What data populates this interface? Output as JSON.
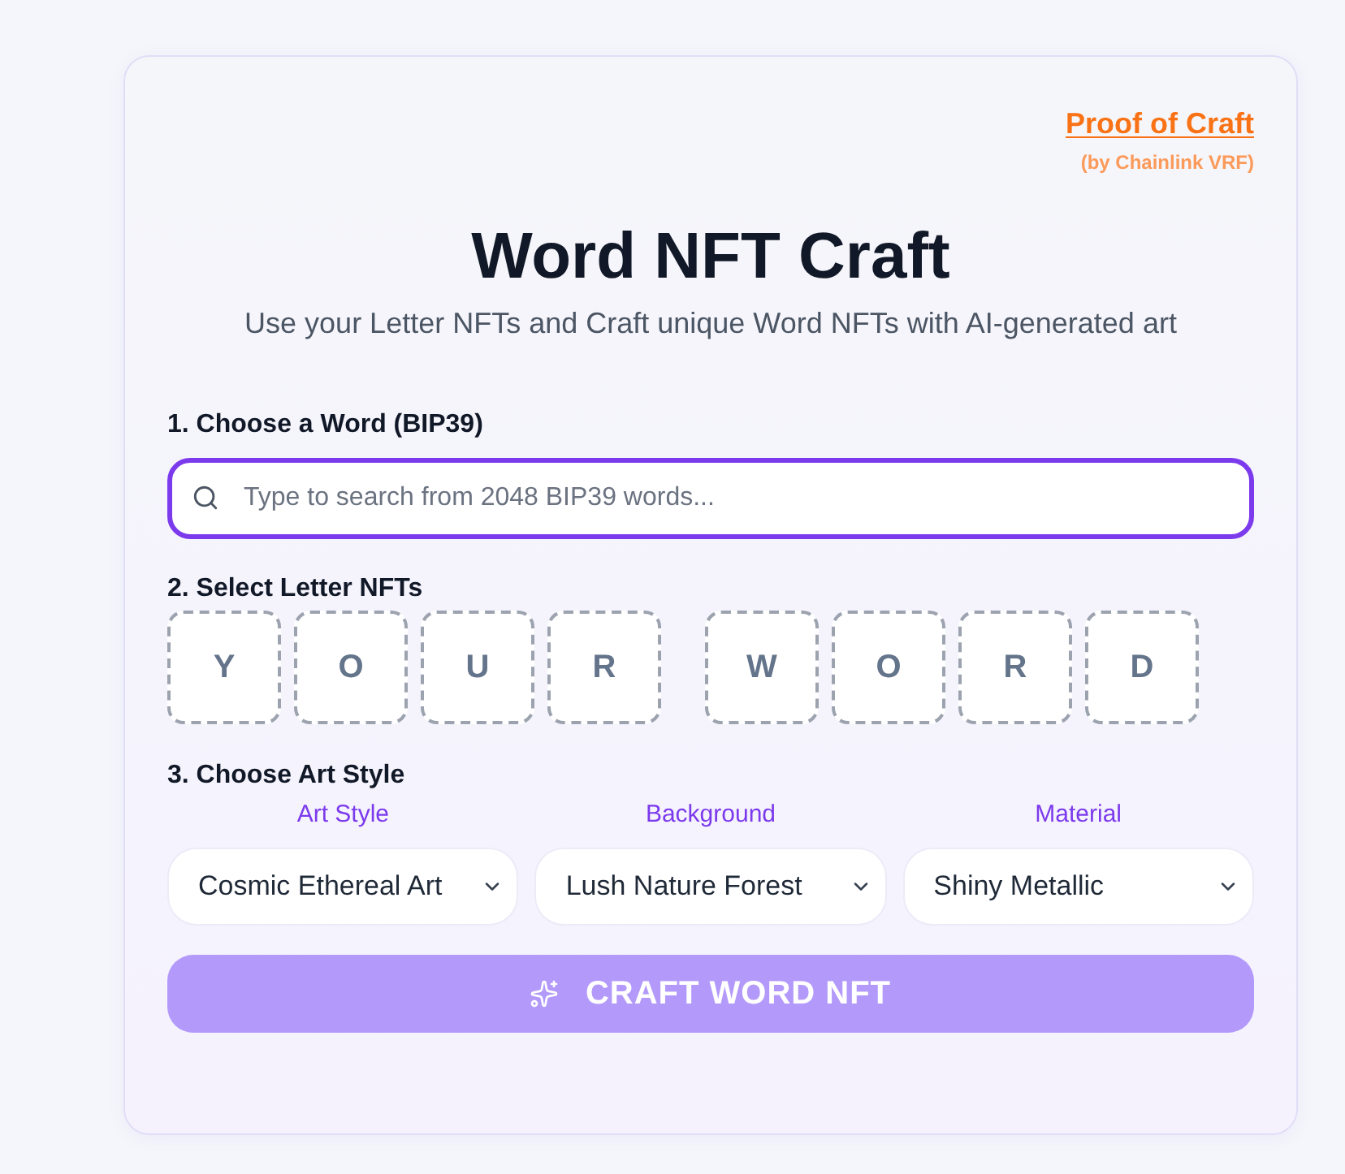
{
  "header": {
    "link": "Proof of Craft",
    "note": "(by Chainlink VRF)"
  },
  "title": "Word NFT Craft",
  "subtitle": "Use your Letter NFTs and Craft unique Word NFTs with AI-generated art",
  "word_step": {
    "label": "1. Choose a Word (BIP39)",
    "search": {
      "placeholder": "Type to search from 2048 BIP39 words...",
      "focused": true
    }
  },
  "letters_step": {
    "label": "2. Select Letter NFTs",
    "words": [
      {
        "letters": [
          {
            "char": "Y",
            "filled": false
          },
          {
            "char": "O",
            "filled": false
          },
          {
            "char": "U",
            "filled": false
          },
          {
            "char": "R",
            "filled": false
          }
        ]
      },
      {
        "letters": [
          {
            "char": "W",
            "filled": false
          },
          {
            "char": "O",
            "filled": false
          },
          {
            "char": "R",
            "filled": false
          },
          {
            "char": "D",
            "filled": false
          }
        ]
      }
    ]
  },
  "style_step": {
    "label": "3. Choose Art Style",
    "selects": [
      {
        "label": "Art Style",
        "value": "Cosmic Ethereal Art"
      },
      {
        "label": "Background",
        "value": "Lush Nature Forest"
      },
      {
        "label": "Material",
        "value": "Shiny Metallic"
      }
    ]
  },
  "craft_button": {
    "label": "CRAFT WORD NFT",
    "disabled": true
  }
}
